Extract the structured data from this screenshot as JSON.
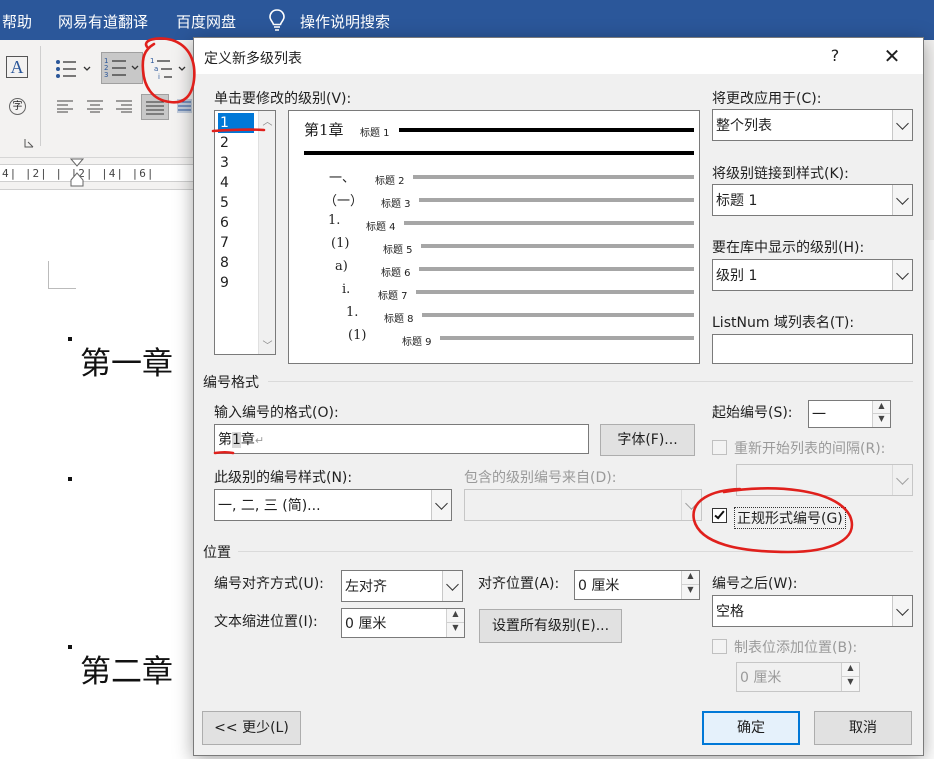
{
  "menu": {
    "items": [
      "帮助",
      "网易有道翻译",
      "百度网盘",
      "操作说明搜索"
    ]
  },
  "ruler": {
    "marks": "4|  |2|  |  |2|  |4|  |6|"
  },
  "document": {
    "chapter1": "第一章",
    "chapter2": "第二章"
  },
  "dialog": {
    "title": "定义新多级列表",
    "help": "?",
    "close": "✕",
    "level_label": "单击要修改的级别(V):",
    "levels": [
      "1",
      "2",
      "3",
      "4",
      "5",
      "6",
      "7",
      "8",
      "9"
    ],
    "selected_level": "1",
    "preview": {
      "level1_number": "第1章",
      "heading_labels": [
        "标题 1",
        "标题 2",
        "标题 3",
        "标题 4",
        "标题 5",
        "标题 6",
        "标题 7",
        "标题 8",
        "标题 9"
      ],
      "numbers": [
        "一、",
        "（一）",
        "1.",
        "(1)",
        "a)",
        "i.",
        "1.",
        "(1)"
      ]
    },
    "apply_to": {
      "label": "将更改应用于(C):",
      "value": "整个列表"
    },
    "link_style": {
      "label": "将级别链接到样式(K):",
      "value": "标题 1"
    },
    "gallery_level": {
      "label": "要在库中显示的级别(H):",
      "value": "级别 1"
    },
    "listnum": {
      "label": "ListNum 域列表名(T):",
      "value": ""
    },
    "number_format": {
      "section": "编号格式",
      "input_label": "输入编号的格式(O):",
      "value_prefix": "第",
      "value_number": "1",
      "value_suffix": "章",
      "para_mark": "↵",
      "font_button": "字体(F)...",
      "style_label": "此级别的编号样式(N):",
      "style_value": "一, 二, 三 (简)...",
      "include_label": "包含的级别编号来自(D):",
      "include_value": "",
      "start_label": "起始编号(S):",
      "start_value": "一",
      "restart_label": "重新开始列表的间隔(R):",
      "restart_value": "",
      "legal_label": "正规形式编号(G)",
      "legal_checked": true
    },
    "position": {
      "section": "位置",
      "align_label": "编号对齐方式(U):",
      "align_value": "左对齐",
      "align_at_label": "对齐位置(A):",
      "align_at_value": "0 厘米",
      "indent_label": "文本缩进位置(I):",
      "indent_value": "0 厘米",
      "set_all_button": "设置所有级别(E)...",
      "follow_label": "编号之后(W):",
      "follow_value": "空格",
      "tab_label": "制表位添加位置(B):",
      "tab_value": "0 厘米"
    },
    "buttons": {
      "less": "<< 更少(L)",
      "ok": "确定",
      "cancel": "取消"
    }
  },
  "colors": {
    "menubar": "#2b579a",
    "selection": "#0078d7",
    "annotation": "#e0201c"
  }
}
